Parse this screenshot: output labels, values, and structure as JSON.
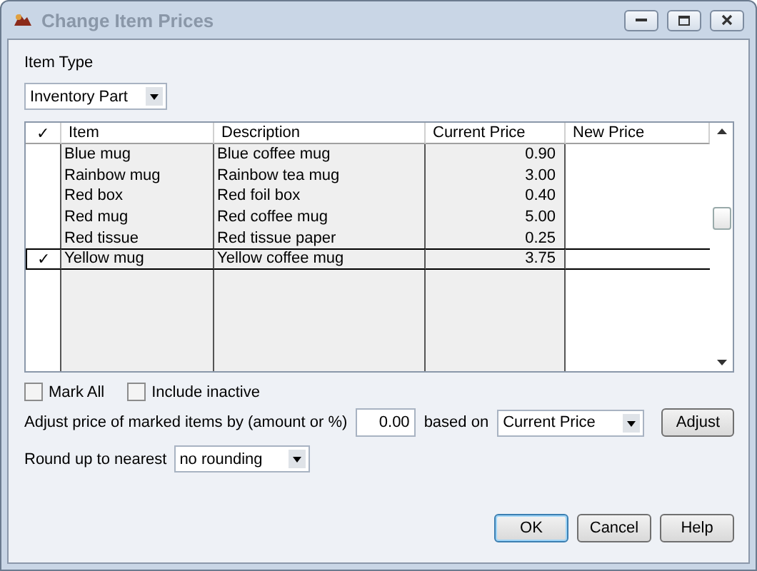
{
  "window": {
    "title": "Change Item Prices"
  },
  "item_type": {
    "label": "Item Type",
    "value": "Inventory Part"
  },
  "table": {
    "columns": [
      "✓",
      "Item",
      "Description",
      "Current Price",
      "New Price"
    ],
    "rows": [
      {
        "item": "Blue mug",
        "description": "Blue coffee mug",
        "current_price": "0.90",
        "checked": false,
        "selected": false
      },
      {
        "item": "Rainbow mug",
        "description": "Rainbow tea mug",
        "current_price": "3.00",
        "checked": false,
        "selected": false
      },
      {
        "item": "Red box",
        "description": "Red foil box",
        "current_price": "0.40",
        "checked": false,
        "selected": false
      },
      {
        "item": "Red mug",
        "description": "Red coffee mug",
        "current_price": "5.00",
        "checked": false,
        "selected": false
      },
      {
        "item": "Red tissue",
        "description": "Red tissue paper",
        "current_price": "0.25",
        "checked": false,
        "selected": false
      },
      {
        "item": "Yellow mug",
        "description": "Yellow coffee mug",
        "current_price": "3.75",
        "checked": true,
        "selected": true
      }
    ],
    "check_glyph": "✓"
  },
  "checkboxes": [
    {
      "label": "Mark All",
      "checked": false
    },
    {
      "label": "Include inactive",
      "checked": false
    }
  ],
  "adjust": {
    "label": "Adjust price of marked items by (amount or %)",
    "value": "0.00",
    "based_on_label": "based on",
    "based_on": "Current Price",
    "button": "Adjust"
  },
  "round": {
    "label": "Round up to nearest",
    "value": "no rounding"
  },
  "buttons": [
    {
      "label": "OK",
      "default": true
    },
    {
      "label": "Cancel",
      "default": false
    },
    {
      "label": "Help",
      "default": false
    }
  ]
}
